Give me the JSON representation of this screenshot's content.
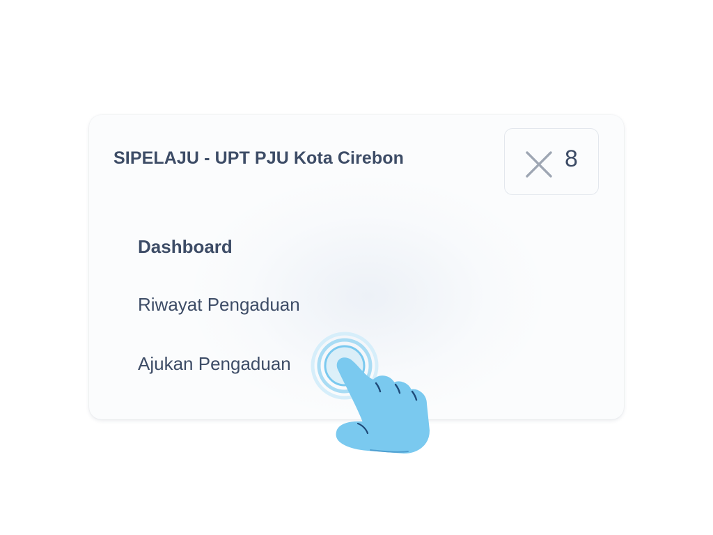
{
  "menu": {
    "title": "SIPELAJU - UPT PJU Kota Cirebon",
    "close_button": {
      "icon": "close-icon",
      "label": "8"
    },
    "items": [
      {
        "label": "Dashboard",
        "active": true
      },
      {
        "label": "Riwayat Pengaduan",
        "active": false
      },
      {
        "label": "Ajukan Pengaduan",
        "active": false
      }
    ]
  },
  "overlay": {
    "icon": "pointing-hand-icon",
    "target": "Ajukan Pengaduan"
  },
  "colors": {
    "text": "#3d4c66",
    "card_background": "#fbfcfd",
    "card_border": "#e3e7ed",
    "hand_fill": "#7ac9ef",
    "hand_outline": "#1f4a78",
    "tap_ring": "#a9dcf4"
  }
}
